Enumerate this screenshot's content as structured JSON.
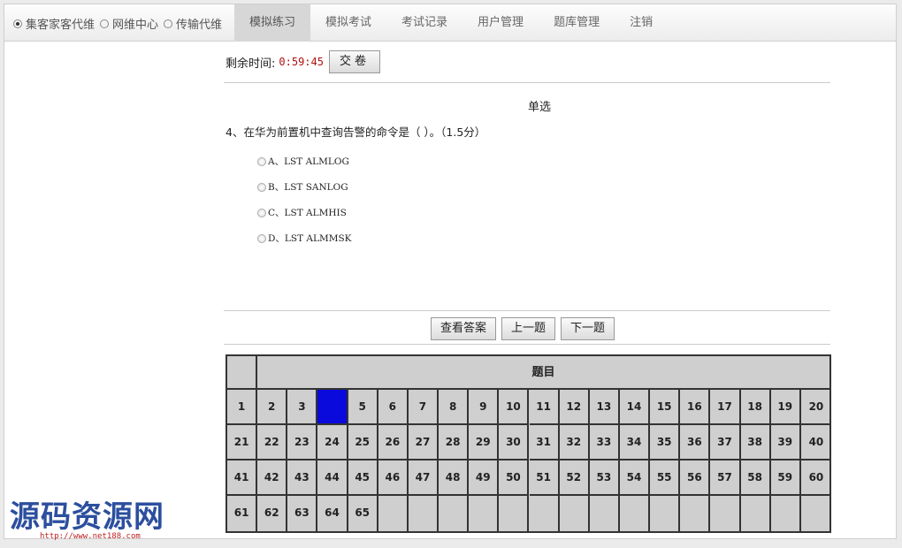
{
  "nav": {
    "radios": [
      {
        "label": "集客家客代维",
        "selected": true
      },
      {
        "label": "网维中心",
        "selected": false
      },
      {
        "label": "传输代维",
        "selected": false
      }
    ],
    "tabs": [
      {
        "label": "模拟练习",
        "active": true
      },
      {
        "label": "模拟考试",
        "active": false
      },
      {
        "label": "考试记录",
        "active": false
      },
      {
        "label": "用户管理",
        "active": false
      },
      {
        "label": "题库管理",
        "active": false
      },
      {
        "label": "注销",
        "active": false
      }
    ]
  },
  "timer": {
    "label": "剩余时间:",
    "value": "0:59:45",
    "submit_label": "交卷"
  },
  "question": {
    "type": "单选",
    "text": "4、在华为前置机中查询告警的命令是（ ）。（1.5分）",
    "options": [
      {
        "label": "A、LST ALMLOG"
      },
      {
        "label": "B、LST SANLOG"
      },
      {
        "label": "C、LST ALMHIS"
      },
      {
        "label": "D、LST ALMMSK"
      }
    ]
  },
  "actions": {
    "view_answer": "查看答案",
    "prev": "上一题",
    "next": "下一题"
  },
  "grid": {
    "header": "题目",
    "current": 4,
    "total": 65,
    "current_color": "#0a0adc"
  },
  "watermark": {
    "title": "源码资源网",
    "url": "http://www.net188.com"
  }
}
